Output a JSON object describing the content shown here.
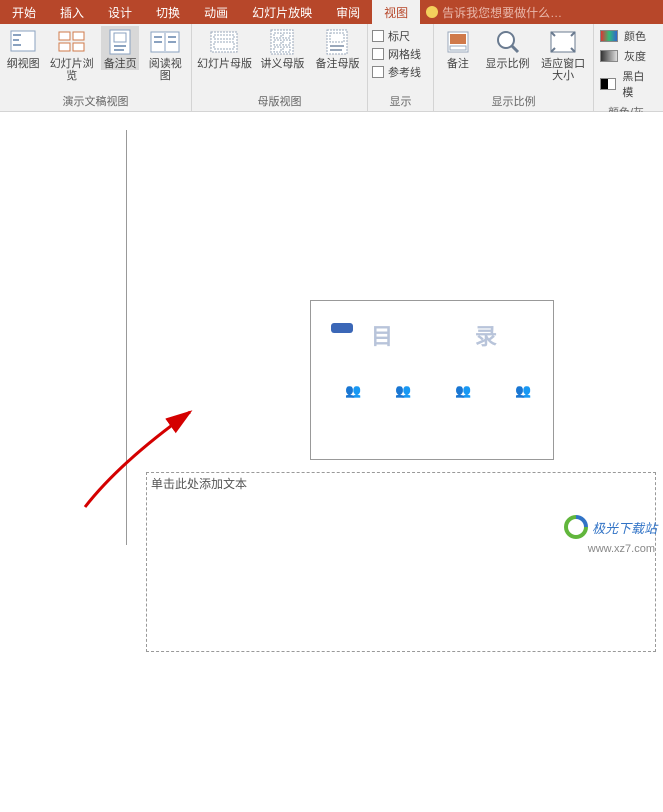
{
  "tabs": {
    "start": "开始",
    "insert": "插入",
    "design": "设计",
    "transition": "切换",
    "animation": "动画",
    "slideshow": "幻灯片放映",
    "review": "审阅",
    "view": "视图"
  },
  "tell_me": "告诉我您想要做什么…",
  "ribbon": {
    "presentation_views": {
      "outline_view": "纲视图",
      "slide_sorter": "幻灯片浏览",
      "notes_page": "备注页",
      "reading_view": "阅读视图",
      "group_label": "演示文稿视图"
    },
    "master_views": {
      "slide_master": "幻灯片母版",
      "handout_master": "讲义母版",
      "notes_master": "备注母版",
      "group_label": "母版视图"
    },
    "show": {
      "ruler": "标尺",
      "gridlines": "网格线",
      "guides": "参考线",
      "group_label": "显示"
    },
    "zoom": {
      "notes": "备注",
      "zoom": "显示比例",
      "fit": "适应窗口大小",
      "group_label": "显示比例"
    },
    "color": {
      "color": "颜色",
      "grayscale": "灰度",
      "bw": "黑白模",
      "group_label": "颜色/灰"
    }
  },
  "slide": {
    "char1": "目",
    "char2": "录"
  },
  "notes_placeholder": "单击此处添加文本",
  "watermark": {
    "name": "极光下载站",
    "url": "www.xz7.com"
  }
}
